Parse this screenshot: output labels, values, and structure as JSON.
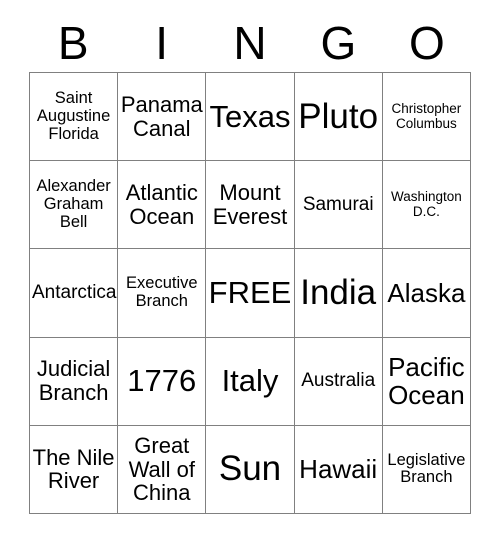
{
  "card": {
    "title": "BINGO",
    "header_letters": [
      "B",
      "I",
      "N",
      "G",
      "O"
    ],
    "free_space_label": "FREE",
    "colors": {
      "text": "#000000",
      "grid_line": "#808080",
      "background": "#ffffff"
    },
    "rows": [
      [
        {
          "text": "Saint Augustine Florida",
          "size": "fs-sm"
        },
        {
          "text": "Panama Canal",
          "size": "fs-lg"
        },
        {
          "text": "Texas",
          "size": "fs-xxl"
        },
        {
          "text": "Pluto",
          "size": "fs-huge"
        },
        {
          "text": "Christopher Columbus",
          "size": "fs-xs"
        }
      ],
      [
        {
          "text": "Alexander Graham Bell",
          "size": "fs-sm"
        },
        {
          "text": "Atlantic Ocean",
          "size": "fs-lg"
        },
        {
          "text": "Mount Everest",
          "size": "fs-lg"
        },
        {
          "text": "Samurai",
          "size": "fs-md"
        },
        {
          "text": "Washington D.C.",
          "size": "fs-xs"
        }
      ],
      [
        {
          "text": "Antarctica",
          "size": "fs-md"
        },
        {
          "text": "Executive Branch",
          "size": "fs-sm"
        },
        {
          "text": "FREE",
          "size": "fs-xxl"
        },
        {
          "text": "India",
          "size": "fs-huge"
        },
        {
          "text": "Alaska",
          "size": "fs-xl"
        }
      ],
      [
        {
          "text": "Judicial Branch",
          "size": "fs-lg"
        },
        {
          "text": "1776",
          "size": "fs-xxl"
        },
        {
          "text": "Italy",
          "size": "fs-xxl"
        },
        {
          "text": "Australia",
          "size": "fs-md"
        },
        {
          "text": "Pacific Ocean",
          "size": "fs-xl"
        }
      ],
      [
        {
          "text": "The Nile River",
          "size": "fs-lg"
        },
        {
          "text": "Great Wall of China",
          "size": "fs-lg"
        },
        {
          "text": "Sun",
          "size": "fs-huge"
        },
        {
          "text": "Hawaii",
          "size": "fs-xl"
        },
        {
          "text": "Legislative Branch",
          "size": "fs-sm"
        }
      ]
    ]
  }
}
